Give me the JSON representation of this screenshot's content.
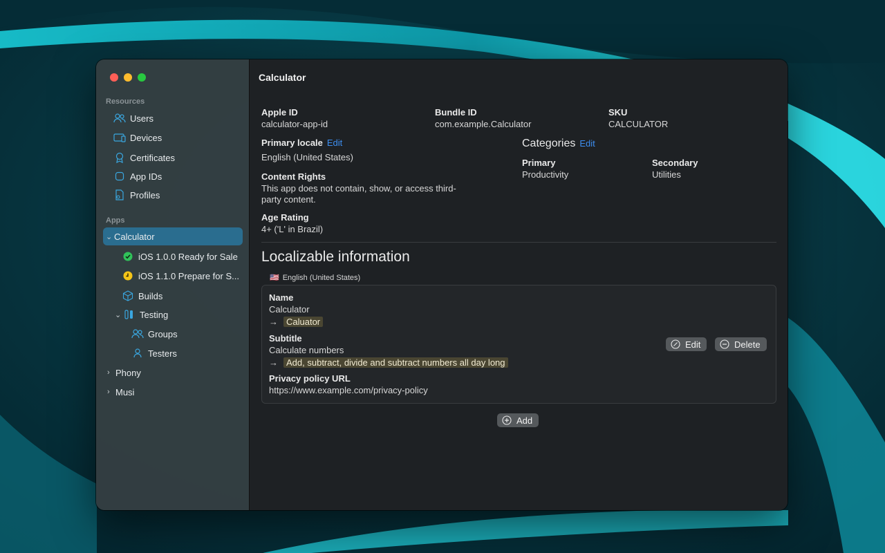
{
  "window": {
    "title": "Calculator"
  },
  "sidebar": {
    "resources_label": "Resources",
    "resources": [
      {
        "label": "Users",
        "icon": "users-icon"
      },
      {
        "label": "Devices",
        "icon": "devices-icon"
      },
      {
        "label": "Certificates",
        "icon": "certificate-icon"
      },
      {
        "label": "App IDs",
        "icon": "app-id-icon"
      },
      {
        "label": "Profiles",
        "icon": "profile-icon"
      }
    ],
    "apps_label": "Apps",
    "apps": {
      "calculator": "Calculator",
      "version_ready": "iOS 1.0.0 Ready for Sale",
      "version_prepare": "iOS 1.1.0 Prepare for S...",
      "builds": "Builds",
      "testing": "Testing",
      "groups": "Groups",
      "testers": "Testers",
      "phony": "Phony",
      "musi": "Musi"
    }
  },
  "app_info": {
    "apple_id_label": "Apple ID",
    "apple_id": "calculator-app-id",
    "bundle_id_label": "Bundle ID",
    "bundle_id": "com.example.Calculator",
    "sku_label": "SKU",
    "sku": "CALCULATOR",
    "primary_locale_label": "Primary locale",
    "primary_locale": "English (United States)",
    "edit": "Edit",
    "content_rights_label": "Content Rights",
    "content_rights": "This app does not contain, show, or access third-party content.",
    "age_rating_label": "Age Rating",
    "age_rating": "4+ ('L' in Brazil)",
    "categories_label": "Categories",
    "primary_category_label": "Primary",
    "primary_category": "Productivity",
    "secondary_category_label": "Secondary",
    "secondary_category": "Utilities"
  },
  "localizable": {
    "title": "Localizable information",
    "locale": "English (United States)",
    "flag": "🇺🇸",
    "name_label": "Name",
    "name": "Calculator",
    "name_new": "Caluator",
    "subtitle_label": "Subtitle",
    "subtitle": "Calculate numbers",
    "subtitle_new": "Add, subtract, divide and subtract numbers all day long",
    "privacy_label": "Privacy policy URL",
    "privacy_url": "https://www.example.com/privacy-policy",
    "edit_button": "Edit",
    "delete_button": "Delete",
    "add_button": "Add"
  },
  "colors": {
    "accent": "#3d8ef0",
    "selection": "#2a6d8f",
    "ready_status": "#30c25a",
    "prepare_status": "#f5c518",
    "highlight": "#4a4632"
  }
}
